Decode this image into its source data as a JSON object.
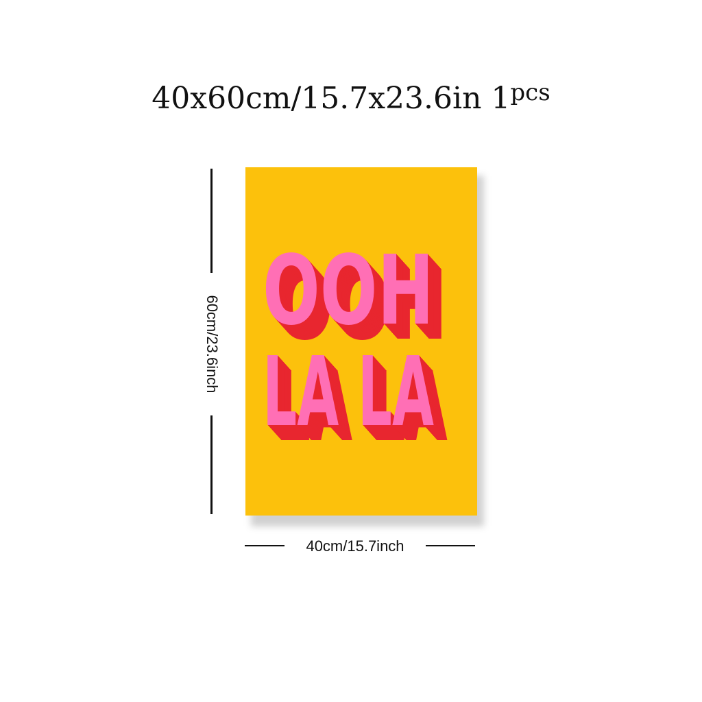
{
  "headline": {
    "size_text": "40x60cm/15.7x23.6in 1",
    "pcs_text": "pcs"
  },
  "dimensions": {
    "height_label": "60cm/23.6inch",
    "width_label": "40cm/15.7inch"
  },
  "poster": {
    "line1": "OOH",
    "line2": "LA LA",
    "colors": {
      "background": "#fcc10c",
      "letter_face": "#ff6fb5",
      "letter_shadow": "#e8262f"
    }
  }
}
